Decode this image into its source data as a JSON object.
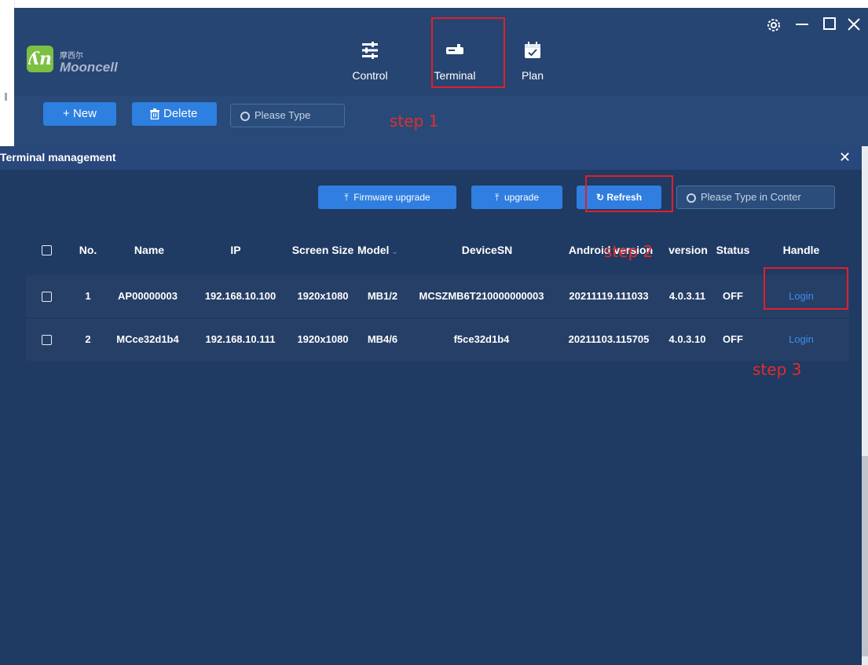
{
  "app": {
    "brand_cn": "摩西尔",
    "brand_en": "Mooncell",
    "nav": [
      {
        "label": "Control"
      },
      {
        "label": "Terminal"
      },
      {
        "label": "Plan"
      }
    ],
    "window_controls": [
      "settings-icon",
      "minimize-icon",
      "maximize-icon",
      "close-icon"
    ]
  },
  "toolbar": {
    "new_label": "+ New",
    "delete_label": "Delete",
    "search_placeholder": "Please Type"
  },
  "annotations": {
    "step1": "step 1",
    "step2": "step 2",
    "step3": "step 3",
    "color": "#e02d2d"
  },
  "dialog": {
    "title": "Terminal management",
    "buttons": {
      "firmware_upgrade": "Firmware upgrade",
      "upgrade": "upgrade",
      "refresh": "Refresh"
    },
    "search_placeholder": "Please Type in Conter",
    "columns": [
      "No.",
      "Name",
      "IP",
      "Screen Size",
      "Model",
      "DeviceSN",
      "Android version",
      "version",
      "Status",
      "Handle"
    ],
    "rows": [
      {
        "no": "1",
        "name": "AP00000003",
        "ip": "192.168.10.100",
        "screen_size": "1920x1080",
        "model": "MB1/2",
        "device_sn": "MCSZMB6T210000000003",
        "android_version": "20211119.111033",
        "version": "4.0.3.11",
        "status": "OFF",
        "handle": "Login"
      },
      {
        "no": "2",
        "name": "MCce32d1b4",
        "ip": "192.168.10.111",
        "screen_size": "1920x1080",
        "model": "MB4/6",
        "device_sn": "f5ce32d1b4",
        "android_version": "20211103.115705",
        "version": "4.0.3.10",
        "status": "OFF",
        "handle": "Login"
      }
    ]
  },
  "colors": {
    "header_bg": "#264572",
    "dialog_bg": "#1f3a63",
    "accent": "#2d7fe0",
    "link": "#3a8ef0",
    "logo": "#7cc043"
  }
}
